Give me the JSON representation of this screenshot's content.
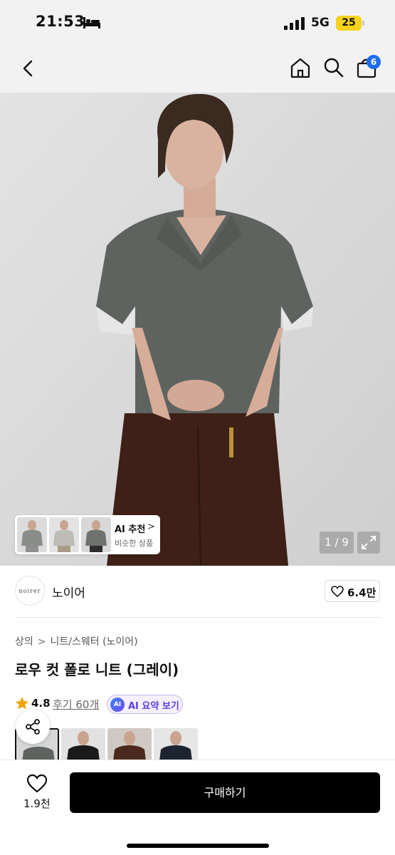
{
  "status_bar": {
    "time": "21:53",
    "network": "5G",
    "battery": "25"
  },
  "nav": {
    "cart_count": "6"
  },
  "hero": {
    "ai_recommend": {
      "title": "AI 추천",
      "chevron": ">",
      "subtitle": "비슷한 상품"
    },
    "page_counter": "1 / 9"
  },
  "brand": {
    "logo_text": "noirer",
    "name": "노이어",
    "like_count": "6.4만"
  },
  "breadcrumb": {
    "items": [
      "상의",
      "니트/스웨터 (노이어)"
    ],
    "separator": ">"
  },
  "product": {
    "title": "로우 컷 폴로 니트 (그레이)"
  },
  "rating": {
    "value": "4.8",
    "reviews": "후기 60개",
    "ai_badge": "AI",
    "ai_summary": "AI 요약 보기"
  },
  "bottom_bar": {
    "wish_count": "1.9천",
    "buy_label": "구매하기"
  },
  "colors": {
    "accent_blue": "#1e6cf0",
    "ai_purple": "#5a3ee0",
    "battery_yellow": "#f5d31b",
    "shirt_gray": "#5f6360",
    "pants_brown": "#3e2018"
  }
}
